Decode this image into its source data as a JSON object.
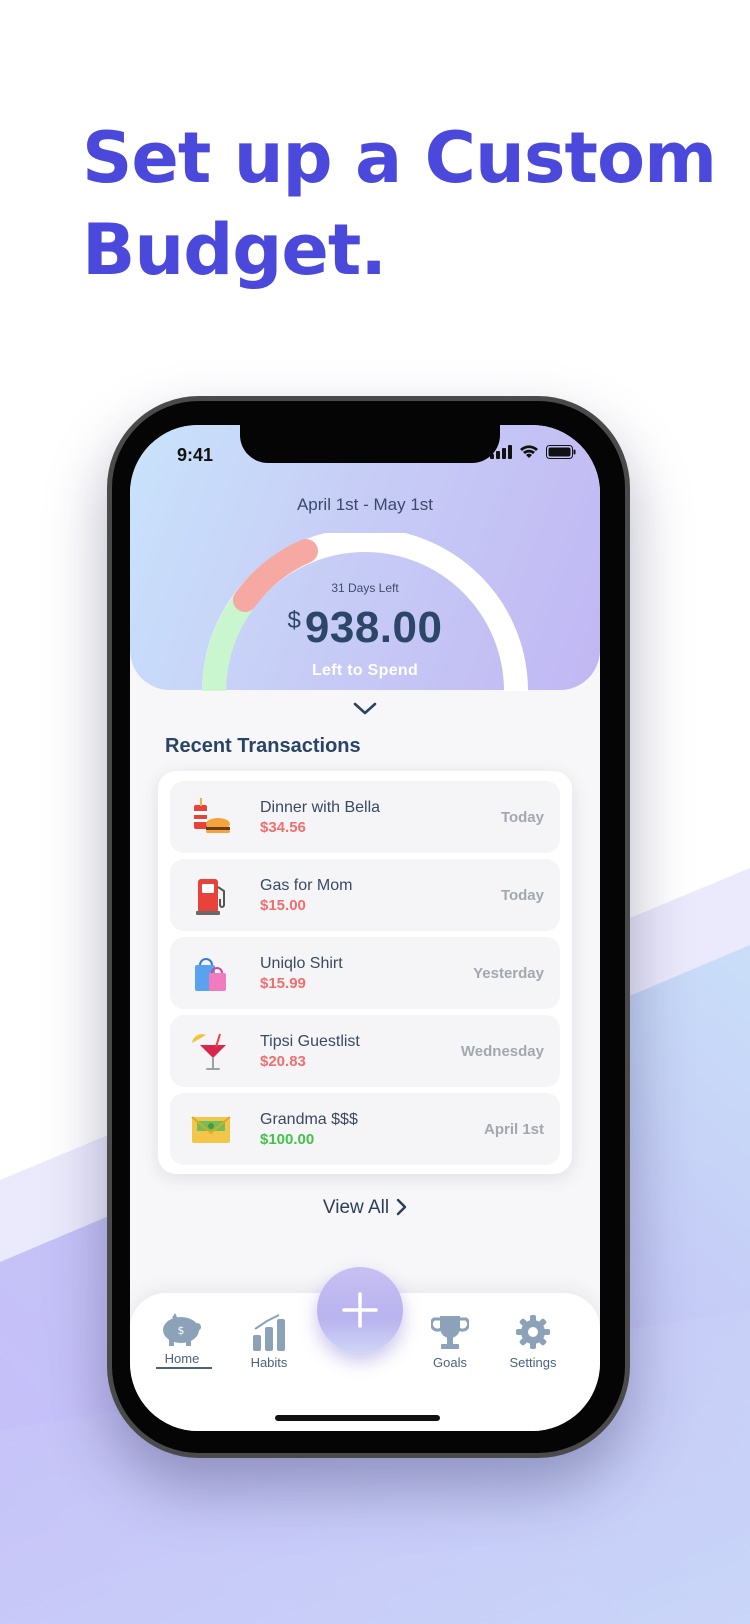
{
  "headline": {
    "line1": "Set up a Custom",
    "line2": "Budget."
  },
  "status_bar": {
    "time": "9:41"
  },
  "budget": {
    "date_range": "April 1st - May 1st",
    "days_left": "31 Days Left",
    "currency": "$",
    "amount": "938.00",
    "amount_label": "Left to Spend"
  },
  "section_title": "Recent Transactions",
  "transactions": [
    {
      "name": "Dinner with Bella",
      "amount": "$34.56",
      "date": "Today",
      "icon": "burger-drink-icon"
    },
    {
      "name": "Gas for Mom",
      "amount": "$15.00",
      "date": "Today",
      "icon": "gas-pump-icon"
    },
    {
      "name": "Uniqlo Shirt",
      "amount": "$15.99",
      "date": "Yesterday",
      "icon": "shopping-bag-icon"
    },
    {
      "name": "Tipsi Guestlist",
      "amount": "$20.83",
      "date": "Wednesday",
      "icon": "cocktail-icon"
    },
    {
      "name": "Grandma $$$",
      "amount": "$100.00",
      "date": "April 1st",
      "icon": "money-envelope-icon"
    }
  ],
  "view_all": "View All",
  "nav": {
    "home": "Home",
    "habits": "Habits",
    "goals": "Goals",
    "settings": "Settings"
  },
  "colors": {
    "headline": "#4b49dc",
    "expense": "#ef6f6f",
    "income": "#43c24a",
    "gauge_green": "#c9f5cf",
    "gauge_red": "#f6a8a3"
  }
}
